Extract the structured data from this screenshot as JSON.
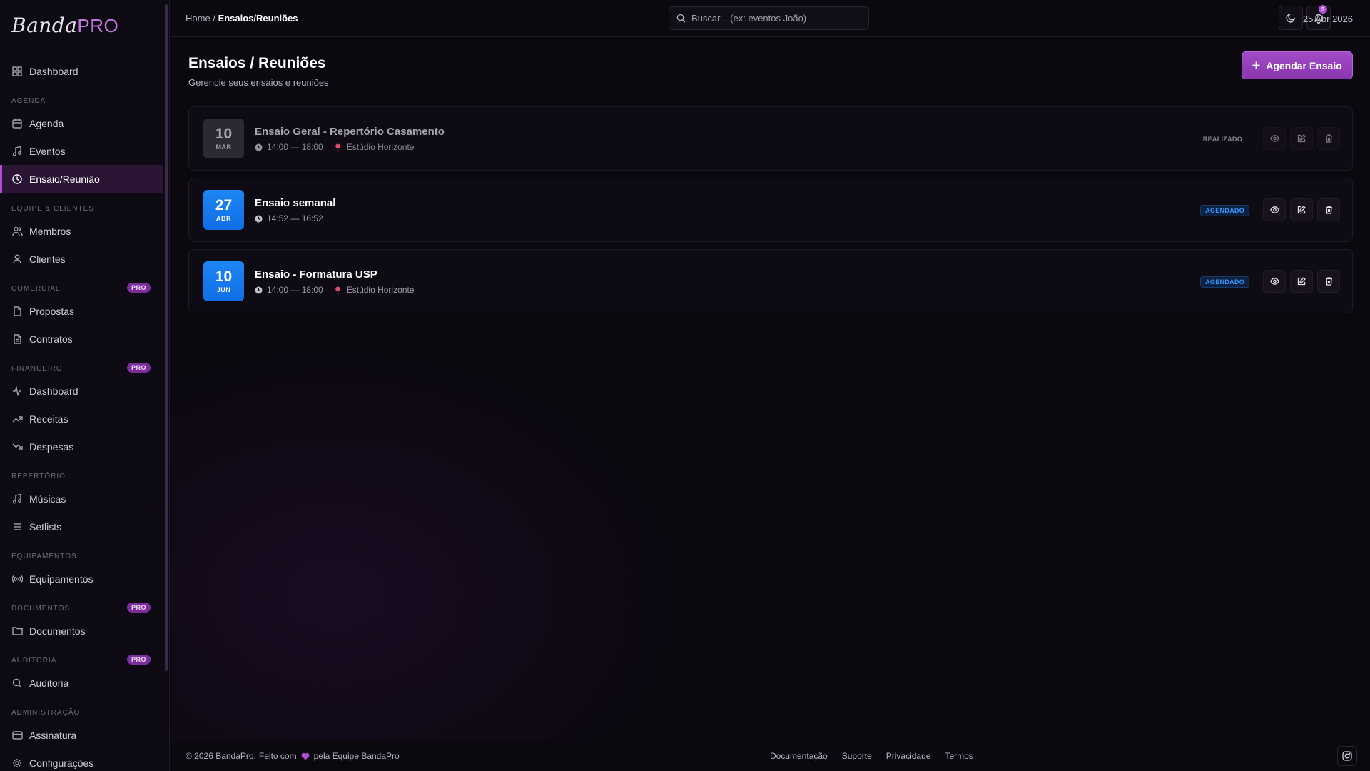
{
  "brand": {
    "logo_script": "Banda",
    "logo_pro": "PRO"
  },
  "sidebar": {
    "items": {
      "dashboard": "Dashboard",
      "agenda": "Agenda",
      "eventos": "Eventos",
      "ensaio": "Ensaio/Reunião",
      "membros": "Membros",
      "clientes": "Clientes",
      "propostas": "Propostas",
      "contratos": "Contratos",
      "fin_dashboard": "Dashboard",
      "receitas": "Receitas",
      "despesas": "Despesas",
      "musicas": "Músicas",
      "setlists": "Setlists",
      "equipamentos": "Equipamentos",
      "documentos": "Documentos",
      "auditoria": "Auditoria",
      "assinatura": "Assinatura",
      "configuracoes": "Configurações"
    },
    "sections": {
      "agenda": "AGENDA",
      "equipe": "EQUIPE & CLIENTES",
      "comercial": "COMERCIAL",
      "financeiro": "FINANCEIRO",
      "repertorio": "REPERTÓRIO",
      "equipamentos": "EQUIPAMENTOS",
      "documentos": "DOCUMENTOS",
      "auditoria": "AUDITORIA",
      "administracao": "ADMINISTRAÇÃO"
    },
    "pro_badge": "PRO",
    "active_item": "ensaio"
  },
  "topbar": {
    "breadcrumb_home": "Home",
    "breadcrumb_sep": "/",
    "breadcrumb_current": "Ensaios/Reuniões",
    "search_placeholder": "Buscar... (ex: eventos João)",
    "notification_count": "3",
    "date": "25 Abr 2026"
  },
  "page": {
    "title": "Ensaios / Reuniões",
    "subtitle": "Gerencie seus ensaios e reuniões",
    "primary_button": "Agendar Ensaio"
  },
  "rehearsals": [
    {
      "day": "10",
      "month": "MAR",
      "title": "Ensaio Geral - Repertório Casamento",
      "time": "14:00 — 18:00",
      "location": "Estúdio Horizonte",
      "status": "REALIZADO"
    },
    {
      "day": "27",
      "month": "ABR",
      "title": "Ensaio semanal",
      "time": "14:52 — 16:52",
      "location": "",
      "status": "AGENDADO"
    },
    {
      "day": "10",
      "month": "JUN",
      "title": "Ensaio - Formatura USP",
      "time": "14:00 — 18:00",
      "location": "Estúdio Horizonte",
      "status": "AGENDADO"
    }
  ],
  "footer": {
    "copyright": "© 2026 BandaPro.",
    "made_with": "Feito com",
    "by_team": "pela Equipe BandaPro",
    "links": [
      "Documentação",
      "Suporte",
      "Privacidade",
      "Termos"
    ]
  },
  "colors": {
    "accent": "#b04fd6",
    "scheduled_blue": "#1e86f5",
    "background": "#0b0810"
  },
  "icons": {
    "theme_toggle": "moon-icon",
    "notifications": "bell-icon",
    "search": "search-icon",
    "view": "eye-icon",
    "edit": "edit-icon",
    "delete": "trash-icon",
    "clock": "clock-icon",
    "location": "pin-icon",
    "social": "instagram-icon"
  }
}
